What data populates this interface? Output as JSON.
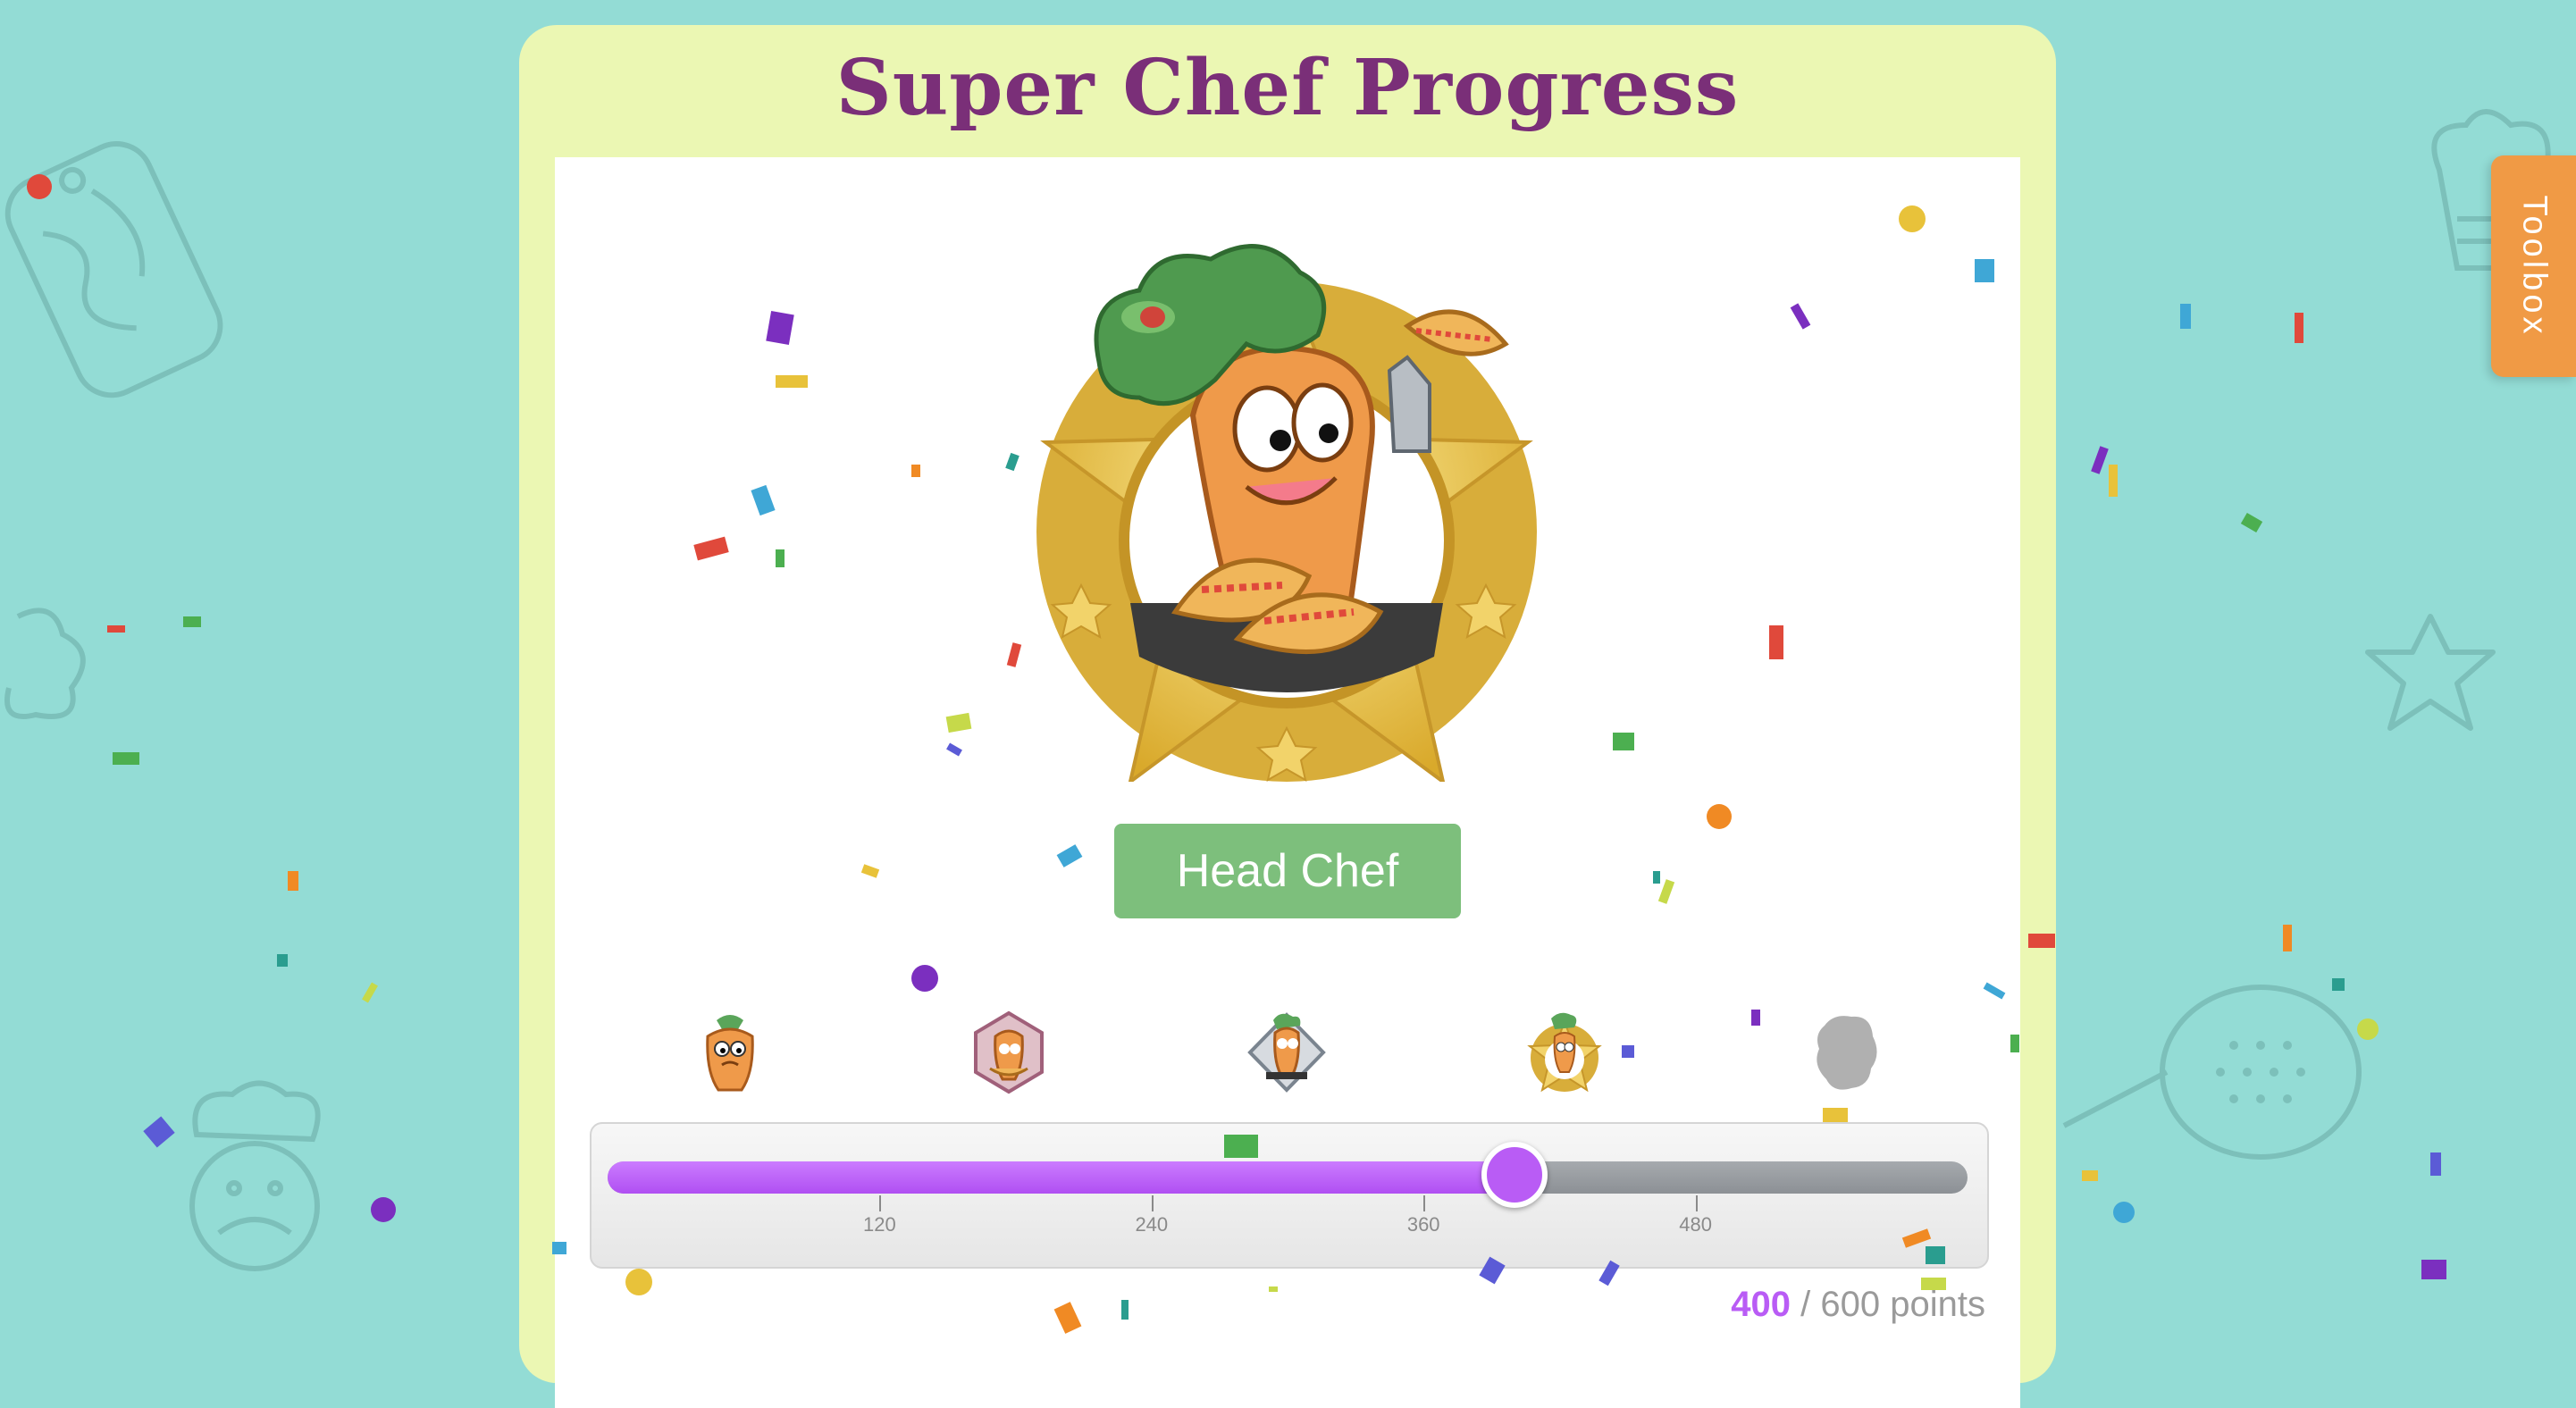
{
  "page": {
    "title": "Super Chef Progress",
    "rank_label": "Head Chef",
    "toolbox_label": "Toolbox"
  },
  "milestones": [
    {
      "name": "carrot-icon",
      "state": "unlocked"
    },
    {
      "name": "hexagon-badge-icon",
      "state": "unlocked"
    },
    {
      "name": "diamond-badge-icon",
      "state": "unlocked"
    },
    {
      "name": "star-badge-icon",
      "state": "current"
    },
    {
      "name": "locked-badge-icon",
      "state": "locked"
    }
  ],
  "progress": {
    "current": "400",
    "max": 600,
    "separator": "/",
    "suffix": "600 points",
    "ticks": [
      "120",
      "240",
      "360",
      "480"
    ]
  },
  "colors": {
    "background": "#93dcd5",
    "card": "#ebf7b3",
    "title": "#7a2f78",
    "accent": "#b95cf5",
    "rank_button": "#7dbf7c",
    "toolbox": "#f09a45"
  }
}
